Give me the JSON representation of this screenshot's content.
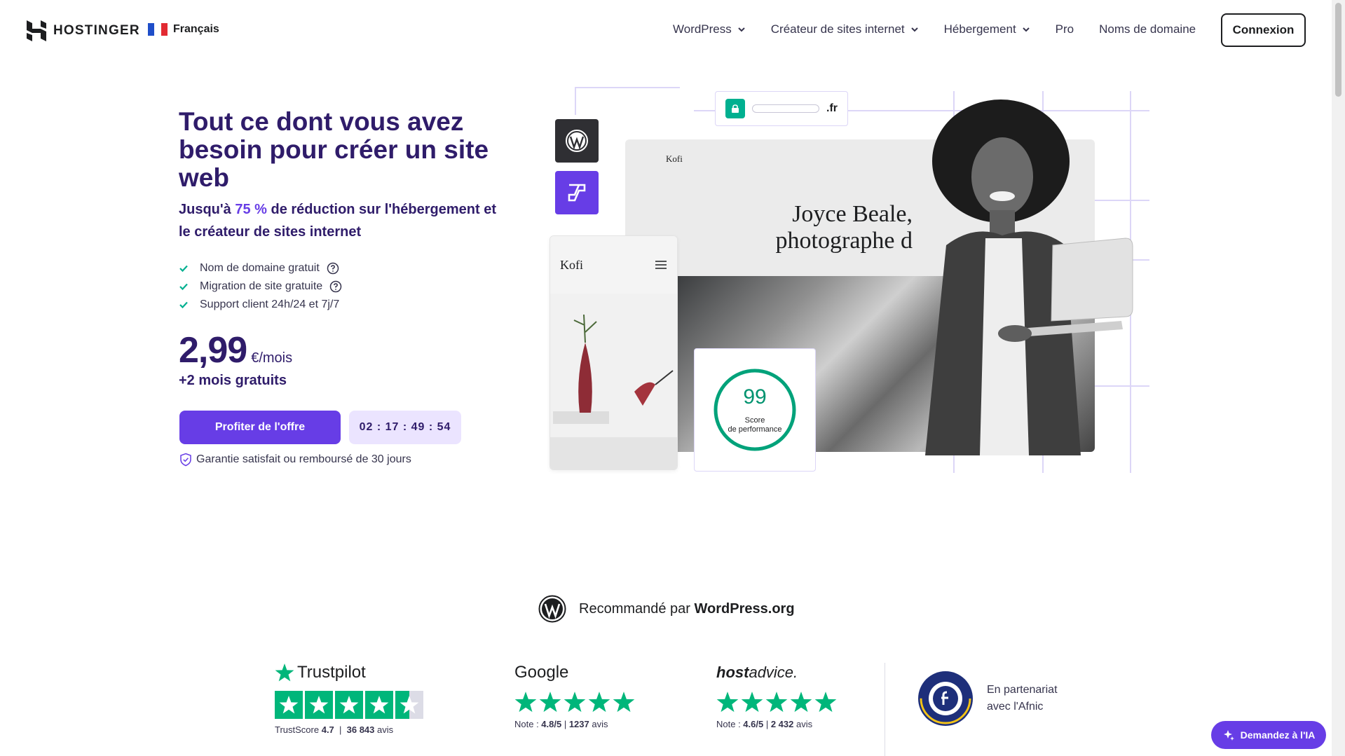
{
  "header": {
    "brand": "HOSTINGER",
    "language": "Français",
    "nav": [
      {
        "label": "WordPress",
        "dropdown": true
      },
      {
        "label": "Créateur de sites internet",
        "dropdown": true
      },
      {
        "label": "Hébergement",
        "dropdown": true
      },
      {
        "label": "Pro",
        "dropdown": false
      },
      {
        "label": "Noms de domaine",
        "dropdown": false
      }
    ],
    "login": "Connexion"
  },
  "hero": {
    "title": "Tout ce dont vous avez besoin pour créer un site web",
    "subtitle_prefix": "Jusqu'à ",
    "subtitle_accent": "75 %",
    "subtitle_suffix": " de réduction sur l'hébergement et le créateur de sites internet",
    "features": [
      {
        "label": "Nom de domaine gratuit",
        "help": true
      },
      {
        "label": "Migration de site gratuite",
        "help": true
      },
      {
        "label": "Support client 24h/24 et 7j/7",
        "help": false
      }
    ],
    "price": "2,99",
    "price_unit": "€/mois",
    "bonus": "+2 mois gratuits",
    "cta": "Profiter de l'offre",
    "timer": "02 : 17 : 49 : 54",
    "guarantee": "Garantie satisfait ou remboursé de 30 jours"
  },
  "illustration": {
    "url_tld": ".fr",
    "site_brand": "Kofi",
    "site_headline_1": "Joyce Beale,",
    "site_headline_2": "photographe d",
    "mobile_brand": "Kofi",
    "score": "99",
    "score_label_1": "Score",
    "score_label_2": "de performance"
  },
  "recommend": {
    "prefix": "Recommandé par ",
    "bold": "WordPress.org"
  },
  "ratings": {
    "trustpilot": {
      "logo": "Trustpilot",
      "label": "TrustScore",
      "score": "4.7",
      "count": "36 843",
      "count_suffix": "avis"
    },
    "google": {
      "logo": "Google",
      "label": "Note : ",
      "score": "4.8/5",
      "count": "1237",
      "count_suffix": "avis"
    },
    "hostadvice": {
      "logo_bold": "host",
      "logo_rest": "advice.",
      "label": "Note : ",
      "score": "4.6/5",
      "count": "2 432",
      "count_suffix": "avis"
    },
    "afnic_line1": "En partenariat",
    "afnic_line2": "avec l'Afnic"
  },
  "ai_button": "Demandez à l'IA",
  "colors": {
    "accent": "#673de6",
    "title": "#2f1c6a",
    "green": "#00b67a",
    "score_green": "#00936f"
  }
}
